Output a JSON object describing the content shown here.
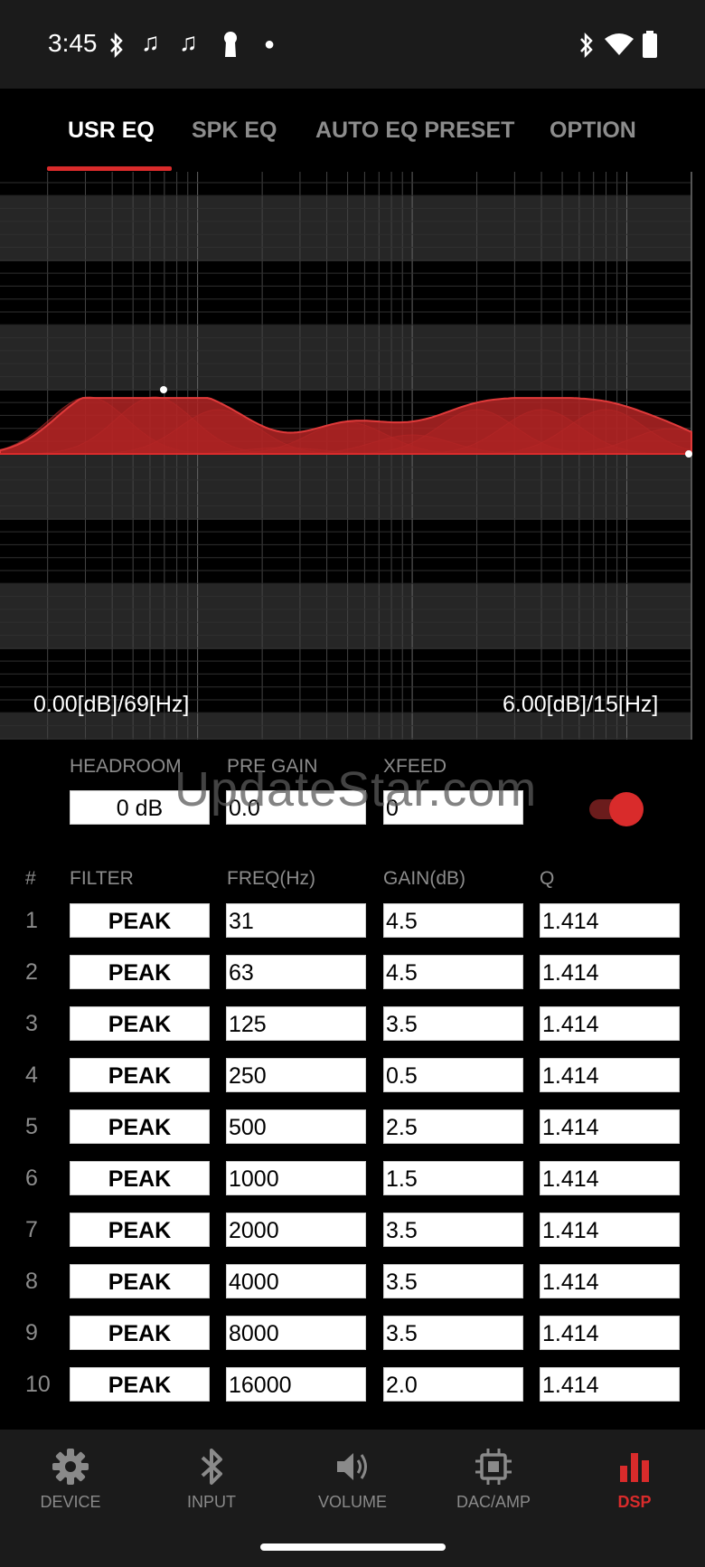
{
  "status_bar": {
    "time": "3:45",
    "left_icons": [
      "bluetooth-icon",
      "music-note-icon",
      "music-note-icon",
      "keyhole-icon",
      "dot-icon"
    ],
    "right_icons": [
      "bluetooth-icon",
      "wifi-icon",
      "battery-icon"
    ]
  },
  "tabs": [
    {
      "label": "USR EQ",
      "active": true
    },
    {
      "label": "SPK EQ",
      "active": false
    },
    {
      "label": "AUTO EQ PRESET",
      "active": false
    },
    {
      "label": "OPTION",
      "active": false
    }
  ],
  "graph": {
    "readout_left": "0.00[dB]/69[Hz]",
    "readout_right": "6.00[dB]/15[Hz]",
    "accent_color": "#d92b2b"
  },
  "controls": {
    "headroom_label": "HEADROOM",
    "headroom_value": "0 dB",
    "pregain_label": "PRE GAIN",
    "pregain_value": "0.0",
    "xfeed_label": "XFEED",
    "xfeed_value": "0",
    "toggle_on": true
  },
  "watermark": "UpdateStar.com",
  "table": {
    "headers": [
      "#",
      "FILTER",
      "FREQ(Hz)",
      "GAIN(dB)",
      "Q"
    ],
    "rows": [
      {
        "num": "1",
        "filter": "PEAK",
        "freq": "31",
        "gain": "4.5",
        "q": "1.414"
      },
      {
        "num": "2",
        "filter": "PEAK",
        "freq": "63",
        "gain": "4.5",
        "q": "1.414"
      },
      {
        "num": "3",
        "filter": "PEAK",
        "freq": "125",
        "gain": "3.5",
        "q": "1.414"
      },
      {
        "num": "4",
        "filter": "PEAK",
        "freq": "250",
        "gain": "0.5",
        "q": "1.414"
      },
      {
        "num": "5",
        "filter": "PEAK",
        "freq": "500",
        "gain": "2.5",
        "q": "1.414"
      },
      {
        "num": "6",
        "filter": "PEAK",
        "freq": "1000",
        "gain": "1.5",
        "q": "1.414"
      },
      {
        "num": "7",
        "filter": "PEAK",
        "freq": "2000",
        "gain": "3.5",
        "q": "1.414"
      },
      {
        "num": "8",
        "filter": "PEAK",
        "freq": "4000",
        "gain": "3.5",
        "q": "1.414"
      },
      {
        "num": "9",
        "filter": "PEAK",
        "freq": "8000",
        "gain": "3.5",
        "q": "1.414"
      },
      {
        "num": "10",
        "filter": "PEAK",
        "freq": "16000",
        "gain": "2.0",
        "q": "1.414"
      }
    ]
  },
  "bottom_nav": [
    {
      "label": "DEVICE",
      "icon": "gear-icon",
      "active": false
    },
    {
      "label": "INPUT",
      "icon": "bluetooth-icon",
      "active": false
    },
    {
      "label": "VOLUME",
      "icon": "speaker-icon",
      "active": false
    },
    {
      "label": "DAC/AMP",
      "icon": "chip-icon",
      "active": false
    },
    {
      "label": "DSP",
      "icon": "bar-chart-icon",
      "active": true
    }
  ]
}
